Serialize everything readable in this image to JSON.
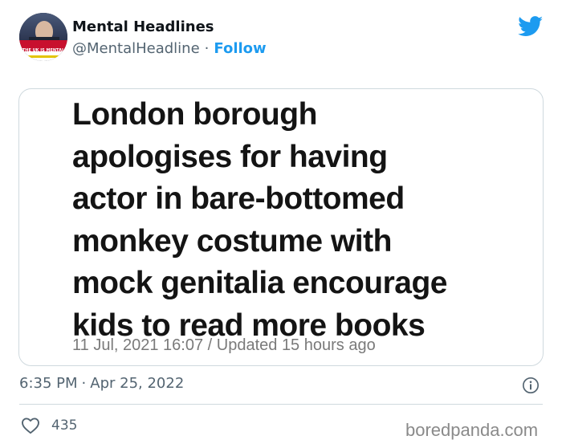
{
  "author": {
    "name": "Mental Headlines",
    "handle": "@MentalHeadline",
    "separator": "·",
    "follow_label": "Follow",
    "avatar_text": "THE UK IS MENTAL"
  },
  "image": {
    "headline_lines": [
      "London borough",
      "apologises for having",
      "actor in bare-bottomed",
      "monkey costume with",
      "mock genitalia encourage",
      "kids to read more books"
    ],
    "dateline": "11 Jul, 2021 16:07 / Updated 15 hours ago"
  },
  "meta": {
    "time": "6:35 PM",
    "separator": "·",
    "date": "Apr 25, 2022"
  },
  "engagement": {
    "likes": "435"
  },
  "watermark": "boredpanda.com",
  "icons": {
    "brand": "twitter-bird-icon",
    "info": "info-icon",
    "like": "heart-icon"
  },
  "colors": {
    "accent": "#1d9bf0",
    "secondary_text": "#536471",
    "border": "#cfd9de",
    "avatar_banner": "#c8102e"
  }
}
